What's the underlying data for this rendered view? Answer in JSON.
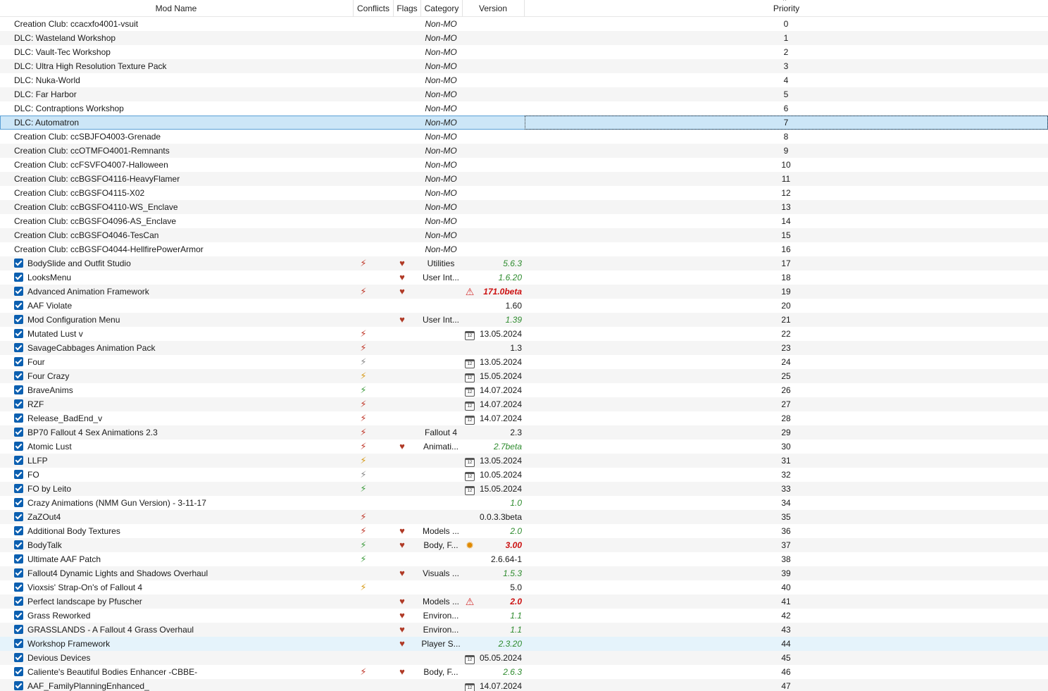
{
  "columns": {
    "name": "Mod Name",
    "conflicts": "Conflicts",
    "flags": "Flags",
    "category": "Category",
    "version": "Version",
    "priority": "Priority",
    "sort_indicator": "^"
  },
  "colors": {
    "selected_row": "#cce6f7",
    "hover_row": "#e5f3fb",
    "checkbox": "#0b5fb0",
    "version_green": "#2e8b2e",
    "version_red": "#cc1111"
  },
  "rows": [
    {
      "name": "Creation Club: ccacxfo4001-vsuit",
      "checked": false,
      "conflict": "",
      "flag": "",
      "category": "Non-MO",
      "vicon": "",
      "version": "",
      "vstyle": "",
      "priority": "0"
    },
    {
      "name": "DLC: Wasteland Workshop",
      "checked": false,
      "conflict": "",
      "flag": "",
      "category": "Non-MO",
      "vicon": "",
      "version": "",
      "vstyle": "",
      "priority": "1"
    },
    {
      "name": "DLC: Vault-Tec Workshop",
      "checked": false,
      "conflict": "",
      "flag": "",
      "category": "Non-MO",
      "vicon": "",
      "version": "",
      "vstyle": "",
      "priority": "2"
    },
    {
      "name": "DLC: Ultra High Resolution Texture Pack",
      "checked": false,
      "conflict": "",
      "flag": "",
      "category": "Non-MO",
      "vicon": "",
      "version": "",
      "vstyle": "",
      "priority": "3"
    },
    {
      "name": "DLC: Nuka-World",
      "checked": false,
      "conflict": "",
      "flag": "",
      "category": "Non-MO",
      "vicon": "",
      "version": "",
      "vstyle": "",
      "priority": "4"
    },
    {
      "name": "DLC: Far Harbor",
      "checked": false,
      "conflict": "",
      "flag": "",
      "category": "Non-MO",
      "vicon": "",
      "version": "",
      "vstyle": "",
      "priority": "5"
    },
    {
      "name": "DLC: Contraptions Workshop",
      "checked": false,
      "conflict": "",
      "flag": "",
      "category": "Non-MO",
      "vicon": "",
      "version": "",
      "vstyle": "",
      "priority": "6"
    },
    {
      "name": "DLC: Automatron",
      "checked": false,
      "conflict": "",
      "flag": "",
      "category": "Non-MO",
      "vicon": "",
      "version": "",
      "vstyle": "",
      "priority": "7",
      "state": "selected"
    },
    {
      "name": "Creation Club: ccSBJFO4003-Grenade",
      "checked": false,
      "conflict": "",
      "flag": "",
      "category": "Non-MO",
      "vicon": "",
      "version": "",
      "vstyle": "",
      "priority": "8"
    },
    {
      "name": "Creation Club: ccOTMFO4001-Remnants",
      "checked": false,
      "conflict": "",
      "flag": "",
      "category": "Non-MO",
      "vicon": "",
      "version": "",
      "vstyle": "",
      "priority": "9"
    },
    {
      "name": "Creation Club: ccFSVFO4007-Halloween",
      "checked": false,
      "conflict": "",
      "flag": "",
      "category": "Non-MO",
      "vicon": "",
      "version": "",
      "vstyle": "",
      "priority": "10"
    },
    {
      "name": "Creation Club: ccBGSFO4116-HeavyFlamer",
      "checked": false,
      "conflict": "",
      "flag": "",
      "category": "Non-MO",
      "vicon": "",
      "version": "",
      "vstyle": "",
      "priority": "11"
    },
    {
      "name": "Creation Club: ccBGSFO4115-X02",
      "checked": false,
      "conflict": "",
      "flag": "",
      "category": "Non-MO",
      "vicon": "",
      "version": "",
      "vstyle": "",
      "priority": "12"
    },
    {
      "name": "Creation Club: ccBGSFO4110-WS_Enclave",
      "checked": false,
      "conflict": "",
      "flag": "",
      "category": "Non-MO",
      "vicon": "",
      "version": "",
      "vstyle": "",
      "priority": "13"
    },
    {
      "name": "Creation Club: ccBGSFO4096-AS_Enclave",
      "checked": false,
      "conflict": "",
      "flag": "",
      "category": "Non-MO",
      "vicon": "",
      "version": "",
      "vstyle": "",
      "priority": "14"
    },
    {
      "name": "Creation Club: ccBGSFO4046-TesCan",
      "checked": false,
      "conflict": "",
      "flag": "",
      "category": "Non-MO",
      "vicon": "",
      "version": "",
      "vstyle": "",
      "priority": "15"
    },
    {
      "name": "Creation Club: ccBGSFO4044-HellfirePowerArmor",
      "checked": false,
      "conflict": "",
      "flag": "",
      "category": "Non-MO",
      "vicon": "",
      "version": "",
      "vstyle": "",
      "priority": "16"
    },
    {
      "name": "BodySlide and Outfit Studio",
      "checked": true,
      "conflict": "bolt-mixed",
      "flag": "flag",
      "category": "Utilities",
      "vicon": "",
      "version": "5.6.3",
      "vstyle": "green",
      "priority": "17"
    },
    {
      "name": "LooksMenu",
      "checked": true,
      "conflict": "",
      "flag": "flag",
      "category": "User Int...",
      "vicon": "",
      "version": "1.6.20",
      "vstyle": "green",
      "priority": "18"
    },
    {
      "name": "Advanced Animation Framework",
      "checked": true,
      "conflict": "bolt-mixed",
      "flag": "flag",
      "category": "",
      "vicon": "warning",
      "version": "171.0beta",
      "vstyle": "red",
      "priority": "19"
    },
    {
      "name": "AAF Violate",
      "checked": true,
      "conflict": "",
      "flag": "",
      "category": "",
      "vicon": "",
      "version": "1.60",
      "vstyle": "black",
      "priority": "20"
    },
    {
      "name": "Mod Configuration Menu",
      "checked": true,
      "conflict": "",
      "flag": "flag",
      "category": "User Int...",
      "vicon": "",
      "version": "1.39",
      "vstyle": "green",
      "priority": "21"
    },
    {
      "name": "Mutated Lust v",
      "checked": true,
      "conflict": "bolt-mixed",
      "flag": "",
      "category": "",
      "vicon": "calendar",
      "version": "13.05.2024",
      "vstyle": "black",
      "priority": "22"
    },
    {
      "name": "SavageCabbages Animation Pack",
      "checked": true,
      "conflict": "bolt-mixed",
      "flag": "",
      "category": "",
      "vicon": "",
      "version": "1.3",
      "vstyle": "black",
      "priority": "23"
    },
    {
      "name": "Four",
      "checked": true,
      "conflict": "bolt-gray",
      "flag": "",
      "category": "",
      "vicon": "calendar",
      "version": "13.05.2024",
      "vstyle": "black",
      "priority": "24"
    },
    {
      "name": "Four Crazy",
      "checked": true,
      "conflict": "bolt-plus",
      "flag": "",
      "category": "",
      "vicon": "calendar",
      "version": "15.05.2024",
      "vstyle": "black",
      "priority": "25"
    },
    {
      "name": "BraveAnims",
      "checked": true,
      "conflict": "bolt-green",
      "flag": "",
      "category": "",
      "vicon": "calendar",
      "version": "14.07.2024",
      "vstyle": "black",
      "priority": "26"
    },
    {
      "name": "RZF",
      "checked": true,
      "conflict": "bolt-mixed",
      "flag": "",
      "category": "",
      "vicon": "calendar",
      "version": "14.07.2024",
      "vstyle": "black",
      "priority": "27"
    },
    {
      "name": "Release_BadEnd_v",
      "checked": true,
      "conflict": "bolt-mixed",
      "flag": "",
      "category": "",
      "vicon": "calendar",
      "version": "14.07.2024",
      "vstyle": "black",
      "priority": "28"
    },
    {
      "name": "BP70 Fallout 4 Sex Animations 2.3",
      "checked": true,
      "conflict": "bolt-mixed",
      "flag": "",
      "category": "Fallout 4",
      "vicon": "",
      "version": "2.3",
      "vstyle": "black",
      "priority": "29"
    },
    {
      "name": "Atomic Lust",
      "checked": true,
      "conflict": "bolt-mixed",
      "flag": "flag",
      "category": "Animati...",
      "vicon": "",
      "version": "2.7beta",
      "vstyle": "green",
      "priority": "30"
    },
    {
      "name": "LLFP",
      "checked": true,
      "conflict": "bolt-plus",
      "flag": "",
      "category": "",
      "vicon": "calendar",
      "version": "13.05.2024",
      "vstyle": "black",
      "priority": "31"
    },
    {
      "name": "FO",
      "checked": true,
      "conflict": "bolt-gray",
      "flag": "",
      "category": "",
      "vicon": "calendar",
      "version": "10.05.2024",
      "vstyle": "black",
      "priority": "32"
    },
    {
      "name": "FO by Leito",
      "checked": true,
      "conflict": "bolt-green",
      "flag": "",
      "category": "",
      "vicon": "calendar",
      "version": "15.05.2024",
      "vstyle": "black",
      "priority": "33"
    },
    {
      "name": "Crazy Animations (NMM Gun Version) - 3-11-17",
      "checked": true,
      "conflict": "",
      "flag": "",
      "category": "",
      "vicon": "",
      "version": "1.0",
      "vstyle": "green",
      "priority": "34"
    },
    {
      "name": "ZaZOut4",
      "checked": true,
      "conflict": "bolt-mixed",
      "flag": "",
      "category": "",
      "vicon": "",
      "version": "0.0.3.3beta",
      "vstyle": "black",
      "priority": "35"
    },
    {
      "name": "Additional Body Textures",
      "checked": true,
      "conflict": "bolt-mixed",
      "flag": "flag",
      "category": "Models ...",
      "vicon": "",
      "version": "2.0",
      "vstyle": "green",
      "priority": "36"
    },
    {
      "name": "BodyTalk",
      "checked": true,
      "conflict": "bolt-green",
      "flag": "flag",
      "category": "Body, F...",
      "vicon": "star",
      "version": "3.00",
      "vstyle": "red",
      "priority": "37"
    },
    {
      "name": "Ultimate AAF Patch",
      "checked": true,
      "conflict": "bolt-green",
      "flag": "",
      "category": "",
      "vicon": "",
      "version": "2.6.64-1",
      "vstyle": "black",
      "priority": "38"
    },
    {
      "name": "Fallout4 Dynamic Lights and Shadows Overhaul",
      "checked": true,
      "conflict": "",
      "flag": "flag",
      "category": "Visuals ...",
      "vicon": "",
      "version": "1.5.3",
      "vstyle": "green",
      "priority": "39"
    },
    {
      "name": "Vioxsis' Strap-On's of Fallout 4",
      "checked": true,
      "conflict": "bolt-plus",
      "flag": "",
      "category": "",
      "vicon": "",
      "version": "5.0",
      "vstyle": "black",
      "priority": "40"
    },
    {
      "name": "Perfect landscape by Pfuscher",
      "checked": true,
      "conflict": "",
      "flag": "flag",
      "category": "Models ...",
      "vicon": "warning",
      "version": "2.0",
      "vstyle": "red",
      "priority": "41"
    },
    {
      "name": "Grass Reworked",
      "checked": true,
      "conflict": "",
      "flag": "flag",
      "category": "Environ...",
      "vicon": "",
      "version": "1.1",
      "vstyle": "green",
      "priority": "42"
    },
    {
      "name": "GRASSLANDS - A Fallout 4 Grass Overhaul",
      "checked": true,
      "conflict": "",
      "flag": "flag",
      "category": "Environ...",
      "vicon": "",
      "version": "1.1",
      "vstyle": "green",
      "priority": "43"
    },
    {
      "name": "Workshop Framework",
      "checked": true,
      "conflict": "",
      "flag": "flag",
      "category": "Player S...",
      "vicon": "",
      "version": "2.3.20",
      "vstyle": "green",
      "priority": "44",
      "state": "hover"
    },
    {
      "name": "Devious Devices",
      "checked": true,
      "conflict": "",
      "flag": "",
      "category": "",
      "vicon": "calendar",
      "version": "05.05.2024",
      "vstyle": "black",
      "priority": "45"
    },
    {
      "name": "Caliente's Beautiful Bodies Enhancer -CBBE-",
      "checked": true,
      "conflict": "bolt-mixed",
      "flag": "flag",
      "category": "Body, F...",
      "vicon": "",
      "version": "2.6.3",
      "vstyle": "green",
      "priority": "46"
    },
    {
      "name": "AAF_FamilyPlanningEnhanced_",
      "checked": true,
      "conflict": "",
      "flag": "",
      "category": "",
      "vicon": "calendar",
      "version": "14.07.2024",
      "vstyle": "black",
      "priority": "47"
    }
  ]
}
